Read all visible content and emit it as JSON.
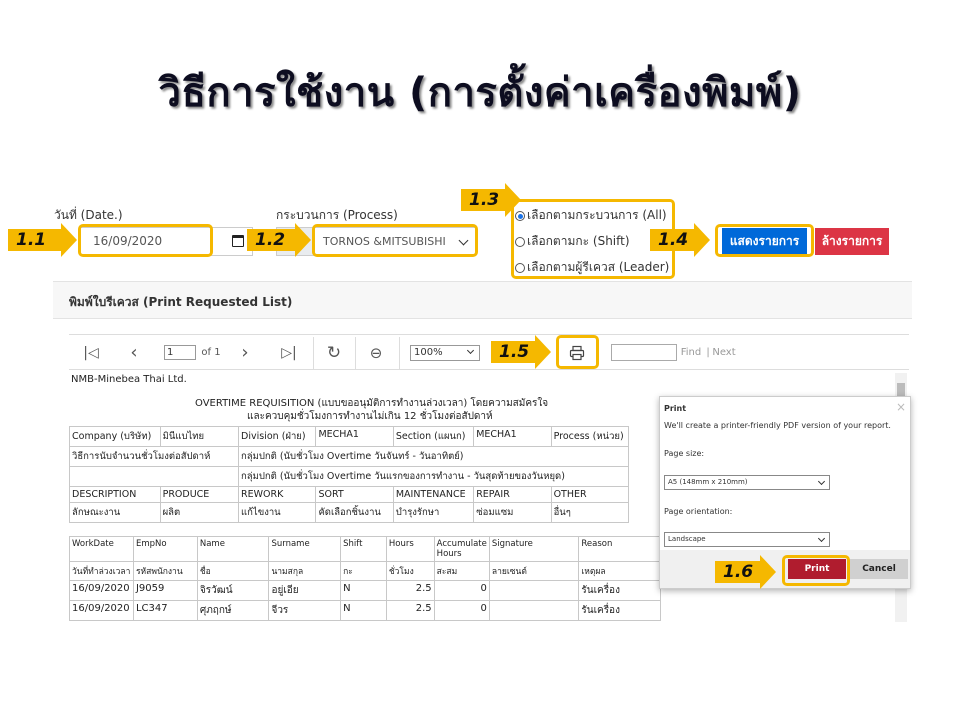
{
  "slide": {
    "title": "วิธีการใช้งาน (การตั้งค่าเครื่องพิมพ์)"
  },
  "form": {
    "date_label": "วันที่ (Date.)",
    "date_value": "16/09/2020",
    "process_label": "กระบวนการ (Process)",
    "process_value": "TORNOS &MITSUBISHI",
    "radios": [
      {
        "label": "เลือกตามกระบวนการ (All)",
        "checked": true
      },
      {
        "label": "เลือกตามกะ (Shift)",
        "checked": false
      },
      {
        "label": "เลือกตามผู้รีเควส (Leader)",
        "checked": false
      }
    ],
    "show_button": "แสดงรายการ",
    "clear_button": "ล้างรายการ"
  },
  "callouts": [
    "1.1",
    "1.2",
    "1.3",
    "1.4",
    "1.5",
    "1.6"
  ],
  "card": {
    "title": "พิมพ์ใบรีเควส (Print Requested List)"
  },
  "viewer": {
    "page_value": "1",
    "page_of": "of 1",
    "zoom": "100%",
    "find_label": "Find",
    "next_label": "Next",
    "sep": "|"
  },
  "report": {
    "company": "NMB-Minebea Thai Ltd.",
    "heading1": "OVERTIME REQUISITION (แบบขออนุมัติการทำงานล่วงเวลา) โดยความสมัครใจ",
    "heading2": "และควบคุมชั่วโมงการทำงานไม่เกิน 12 ชั่วโมงต่อสัปดาห์",
    "info": {
      "company_label": "Company (บริษัท)",
      "company_value": "มินีแบไทย",
      "division_label": "Division (ฝ่าย)",
      "division_value": "MECHA1",
      "section_label": "Section (แผนก)",
      "section_value": "MECHA1",
      "process_label": "Process (หน่วย)",
      "method_label": "วิธีการนับจำนวนชั่วโมงต่อสัปดาห์",
      "method1": "กลุ่มปกติ (นับชั่วโมง Overtime วันจันทร์ - วันอาทิตย์)",
      "method2": "กลุ่มปกติ (นับชั่วโมง Overtime วันแรกของการทำงาน - วันสุดท้ายของวันหยุด)"
    },
    "categories": [
      "DESCRIPTION",
      "PRODUCE",
      "REWORK",
      "SORT",
      "MAINTENANCE",
      "REPAIR",
      "OTHER"
    ],
    "categories_th": [
      "ลักษณะงาน",
      "ผลิต",
      "แก้ไขงาน",
      "คัดเลือกชิ้นงาน",
      "บำรุงรักษา",
      "ซ่อมแซม",
      "อื่นๆ"
    ],
    "columns": [
      "WorkDate",
      "EmpNo",
      "Name",
      "Surname",
      "Shift",
      "Hours",
      "Accumulate Hours",
      "Signature",
      "Reason"
    ],
    "columns_th": [
      "วันที่ทำล่วงเวลา",
      "รหัสพนักงาน",
      "ชื่อ",
      "นามสกุล",
      "กะ",
      "ชั่วโมง",
      "สะสม",
      "ลายเซนต์",
      "เหตุผล"
    ],
    "rows": [
      [
        "16/09/2020",
        "J9059",
        "จิรวัฒน์",
        "อยู่เอีย",
        "N",
        "2.5",
        "0",
        "",
        "รันเครื่อง"
      ],
      [
        "16/09/2020",
        "LC347",
        "ศุภฤกษ์",
        "จีวร",
        "N",
        "2.5",
        "0",
        "",
        "รันเครื่อง"
      ]
    ]
  },
  "print_dialog": {
    "title": "Print",
    "message": "We'll create a printer-friendly PDF version of your report.",
    "size_label": "Page size:",
    "size_value": "A5 (148mm x 210mm)",
    "orientation_label": "Page orientation:",
    "orientation_value": "Landscape",
    "print_button": "Print",
    "cancel_button": "Cancel"
  },
  "colors": {
    "accent": "#f5b800",
    "primary": "#0069d9",
    "danger": "#dc3545",
    "print": "#b01c2e"
  }
}
